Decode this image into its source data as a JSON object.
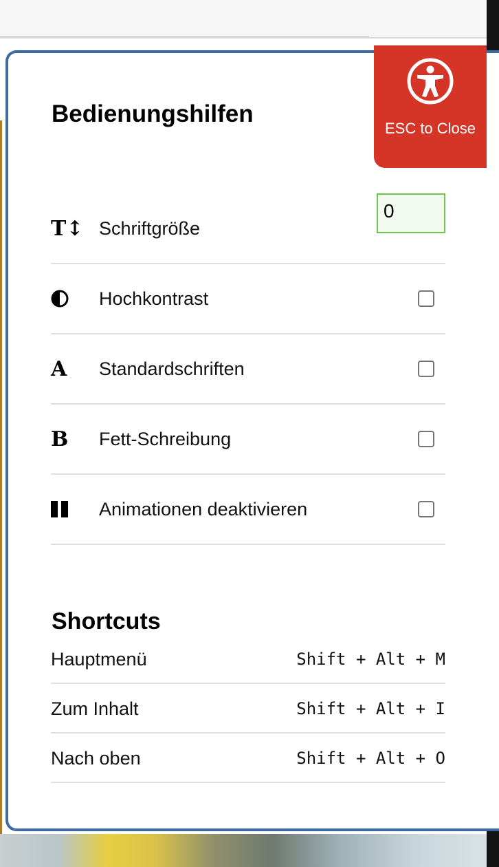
{
  "panel": {
    "title": "Bedienungshilfen",
    "esc_label": "ESC to Close"
  },
  "settings": [
    {
      "icon": "font-size-icon",
      "glyph": "T↕",
      "label": "Schriftgröße",
      "control": "number",
      "value": "0"
    },
    {
      "icon": "contrast-icon",
      "glyph": "◑",
      "label": "Hochkontrast",
      "control": "checkbox",
      "checked": false
    },
    {
      "icon": "serif-font-icon",
      "glyph": "A",
      "label": "Standardschriften",
      "control": "checkbox",
      "checked": false
    },
    {
      "icon": "bold-icon",
      "glyph": "B",
      "label": "Fett-Schreibung",
      "control": "checkbox",
      "checked": false
    },
    {
      "icon": "pause-icon",
      "glyph": "❚❚",
      "label": "Animationen deaktivieren",
      "control": "checkbox",
      "checked": false
    }
  ],
  "shortcuts": {
    "title": "Shortcuts",
    "items": [
      {
        "label": "Hauptmenü",
        "keys": "Shift + Alt + M"
      },
      {
        "label": "Zum Inhalt",
        "keys": "Shift + Alt + I"
      },
      {
        "label": "Nach oben",
        "keys": "Shift + Alt + O"
      }
    ]
  },
  "colors": {
    "accent_red": "#d43526",
    "panel_border": "#3f6aa0",
    "input_border": "#6fc64f"
  }
}
